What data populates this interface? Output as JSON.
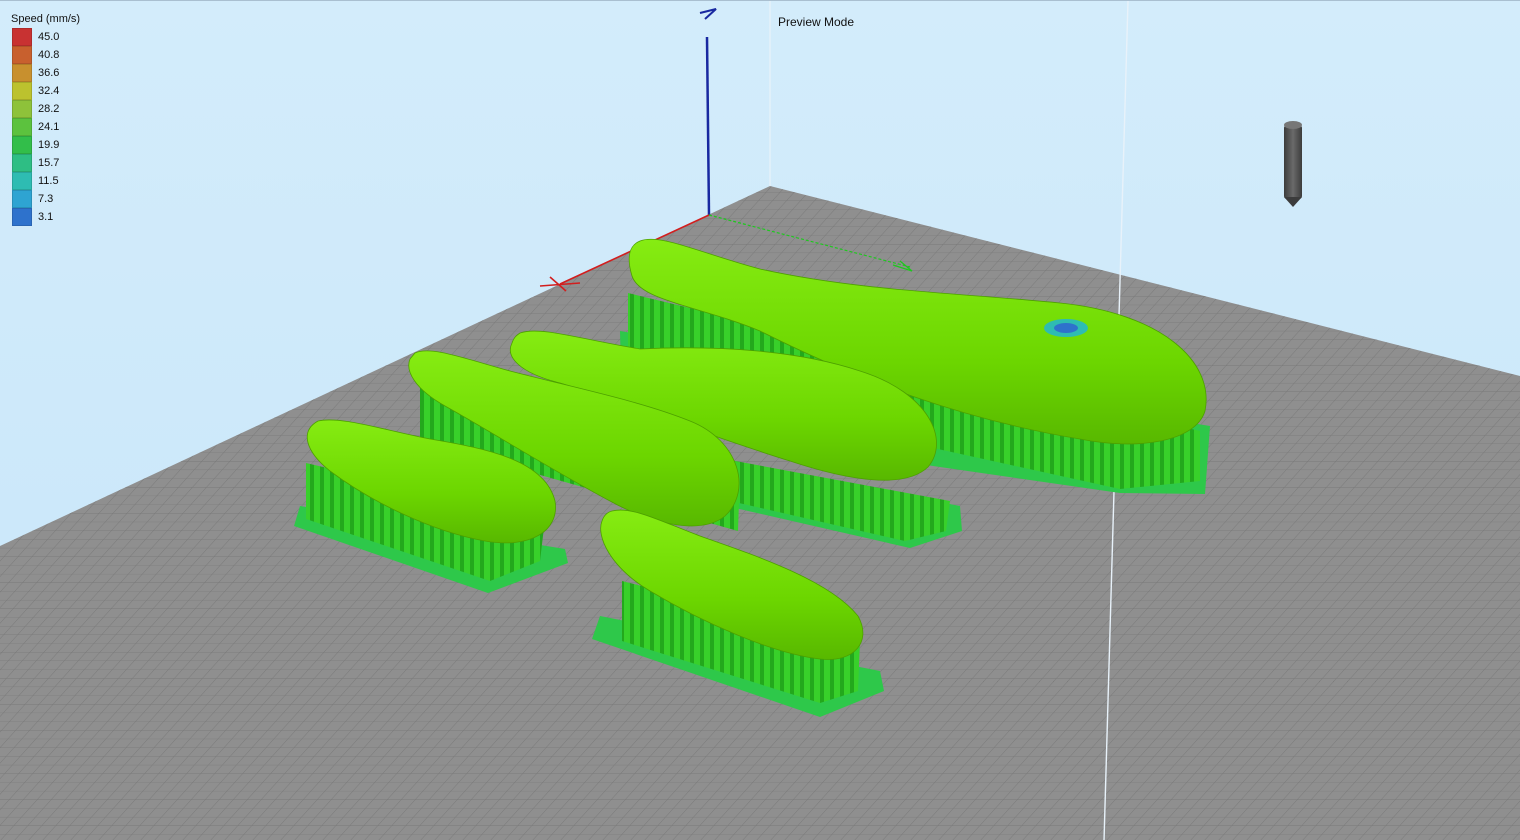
{
  "viewer": {
    "mode_label": "Preview Mode"
  },
  "legend": {
    "title": "Speed (mm/s)",
    "items": [
      {
        "value": "45.0",
        "color": "#c83232"
      },
      {
        "value": "40.8",
        "color": "#c8602e"
      },
      {
        "value": "36.6",
        "color": "#c8902e"
      },
      {
        "value": "32.4",
        "color": "#bcc22e"
      },
      {
        "value": "28.2",
        "color": "#8ec23a"
      },
      {
        "value": "24.1",
        "color": "#5cc23e"
      },
      {
        "value": "19.9",
        "color": "#32be4a"
      },
      {
        "value": "15.7",
        "color": "#2ebe84"
      },
      {
        "value": "11.5",
        "color": "#2ebcb2"
      },
      {
        "value": "7.3",
        "color": "#2ea4d2"
      },
      {
        "value": "3.1",
        "color": "#2e72cc"
      }
    ]
  },
  "scene": {
    "bed_color": "#8e8e8e",
    "grid_line_color": "#747474",
    "model_color": "#6edc00",
    "support_color": "#3ad62e",
    "raft_color": "#2ec84a",
    "axis_x_color": "#d21e1e",
    "axis_y_color": "#1ec81e",
    "axis_z_color": "#1828a0",
    "nozzle_color": "#555555"
  }
}
